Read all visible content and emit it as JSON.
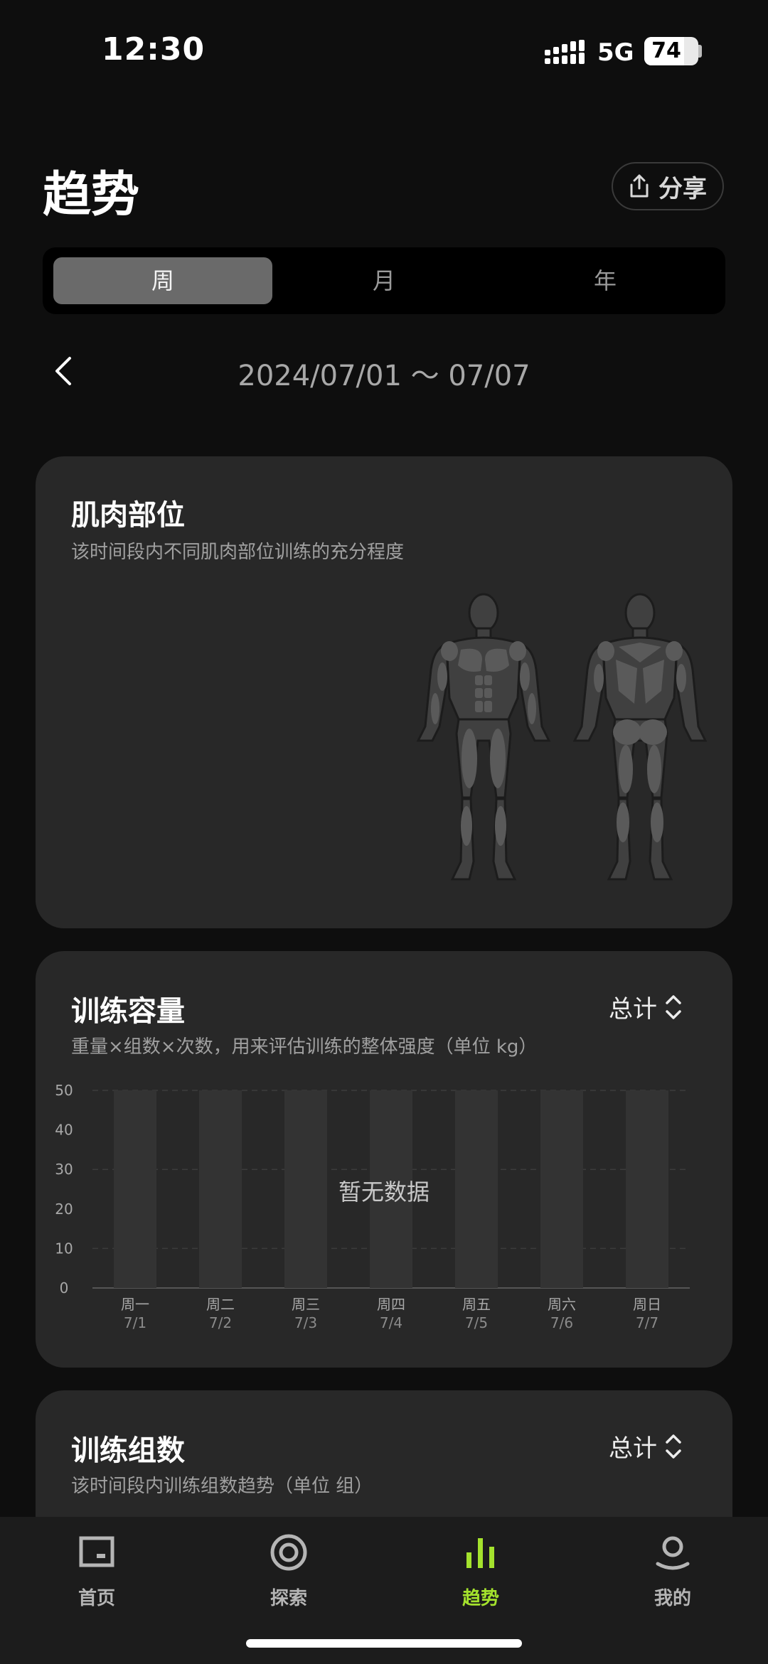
{
  "status_bar": {
    "time": "12:30",
    "network": "5G",
    "battery": "74",
    "battery_level": 0.74
  },
  "header": {
    "title": "趋势",
    "share_label": "分享"
  },
  "period_tabs": [
    {
      "label": "周",
      "active": true
    },
    {
      "label": "月",
      "active": false
    },
    {
      "label": "年",
      "active": false
    }
  ],
  "date_nav": {
    "range": "2024/07/01 ～ 07/07"
  },
  "muscle_card": {
    "title": "肌肉部位",
    "subtitle": "该时间段内不同肌肉部位训练的充分程度"
  },
  "volume_card": {
    "title": "训练容量",
    "subtitle": "重量×组数×次数，用来评估训练的整体强度（单位 kg）",
    "dropdown": "总计",
    "empty": "暂无数据"
  },
  "sets_card": {
    "title": "训练组数",
    "subtitle": "该时间段内训练组数趋势（单位 组）",
    "dropdown": "总计"
  },
  "chart_data": {
    "type": "bar",
    "categories": [
      "周一",
      "周二",
      "周三",
      "周四",
      "周五",
      "周六",
      "周日"
    ],
    "dates": [
      "7/1",
      "7/2",
      "7/3",
      "7/4",
      "7/5",
      "7/6",
      "7/7"
    ],
    "values": [
      null,
      null,
      null,
      null,
      null,
      null,
      null
    ],
    "yticks": [
      0,
      10,
      20,
      30,
      40,
      50
    ],
    "ylim": [
      0,
      50
    ],
    "title": "训练容量",
    "xlabel": "",
    "ylabel": "",
    "grid": true,
    "empty_message": "暂无数据"
  },
  "bottom_nav": [
    {
      "label": "首页",
      "icon": "home-icon",
      "active": false
    },
    {
      "label": "探索",
      "icon": "explore-icon",
      "active": false
    },
    {
      "label": "趋势",
      "icon": "trends-icon",
      "active": true
    },
    {
      "label": "我的",
      "icon": "profile-icon",
      "active": false
    }
  ],
  "colors": {
    "accent": "#a4e22d",
    "card": "#282828",
    "background": "#0e0e0e"
  }
}
